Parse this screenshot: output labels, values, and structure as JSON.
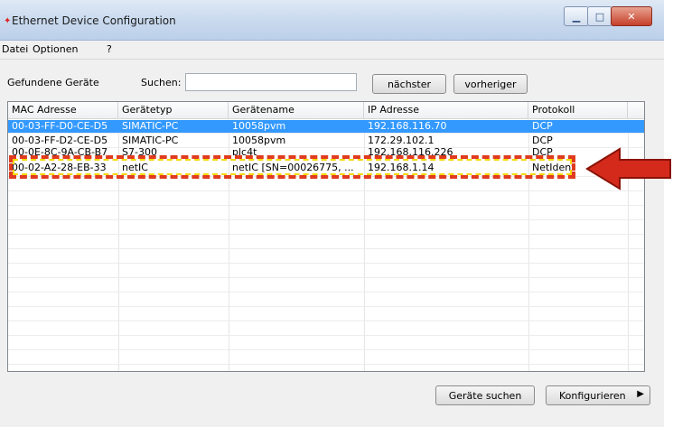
{
  "window": {
    "title": "Ethernet Device Configuration"
  },
  "menu": {
    "file": "Datei",
    "options": "Optionen",
    "help": "?"
  },
  "toolbar": {
    "found_label": "Gefundene Geräte",
    "search_label": "Suchen:",
    "search_value": "",
    "next_label": "nächster",
    "prev_label": "vorheriger"
  },
  "table": {
    "headers": [
      "MAC Adresse",
      "Gerätetyp",
      "Gerätename",
      "IP Adresse",
      "Protokoll"
    ],
    "rows": [
      [
        "00-03-FF-D0-CE-D5",
        "SIMATIC-PC",
        "10058pvm",
        "192.168.116.70",
        "DCP"
      ],
      [
        "00-03-FF-D2-CE-D5",
        "SIMATIC-PC",
        "10058pvm",
        "172.29.102.1",
        "DCP"
      ],
      [
        "00-0E-8C-9A-CB-B7",
        "S7-300",
        "plc4t",
        "192.168.116.226",
        "DCP"
      ],
      [
        "00-02-A2-28-EB-33",
        "netIC",
        "netIC [SN=00026775, ...",
        "192.168.1.14",
        "NetIdent"
      ]
    ]
  },
  "footer": {
    "search_devices": "Geräte suchen",
    "configure": "Konfigurieren"
  },
  "colors": {
    "selection": "#3399ff",
    "highlight_red": "#e03a1f",
    "highlight_yellow": "#f5d90a",
    "arrow": "#d42a1c"
  }
}
